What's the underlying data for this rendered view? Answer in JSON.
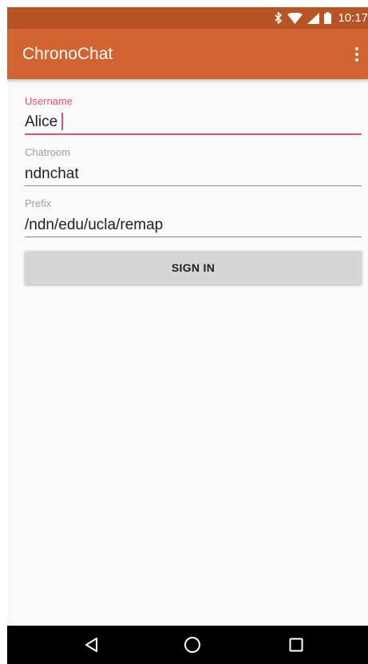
{
  "status_bar": {
    "time": "10:17",
    "icons": [
      "bluetooth-icon",
      "wifi-icon",
      "cellular-signal-icon",
      "battery-icon"
    ],
    "color": "#b85423"
  },
  "app_bar": {
    "title": "ChronoChat",
    "menu_icon": "overflow-menu-icon",
    "color": "#d26432"
  },
  "form": {
    "username": {
      "label": "Username",
      "value": "Alice",
      "focused": true
    },
    "chatroom": {
      "label": "Chatroom",
      "value": "ndnchat"
    },
    "prefix": {
      "label": "Prefix",
      "value": "/ndn/edu/ucla/remap"
    },
    "sign_in_label": "SIGN IN",
    "accent_color": "#e8507c"
  },
  "nav_bar": {
    "buttons": [
      "back-icon",
      "home-icon",
      "recents-icon"
    ]
  }
}
